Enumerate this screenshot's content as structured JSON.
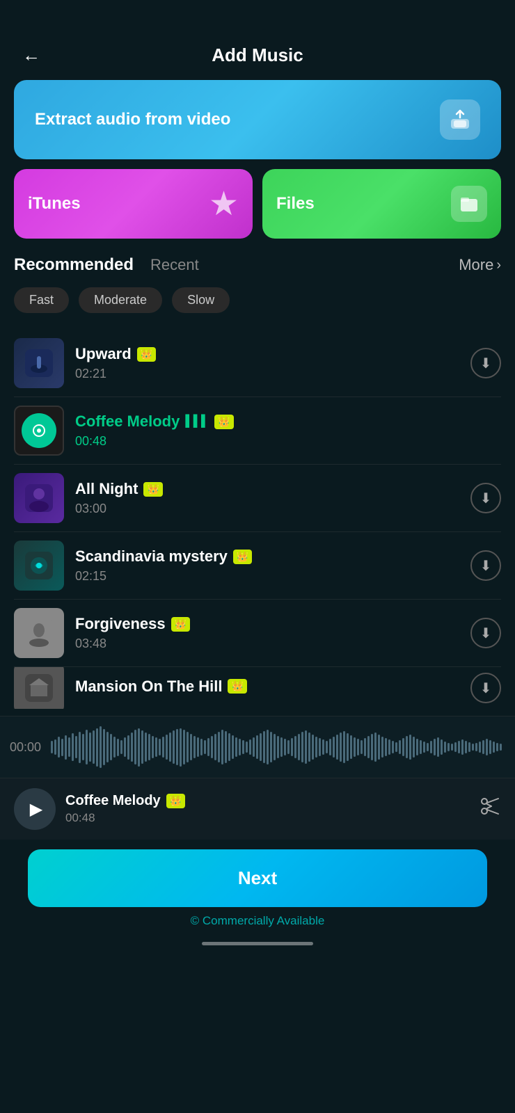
{
  "app": {
    "title": "Add Music",
    "back_label": "←"
  },
  "buttons": {
    "extract_audio": "Extract audio from video",
    "itunes": "iTunes",
    "files": "Files",
    "more": "More",
    "next": "Next",
    "commercially_available": "© Commercially Available"
  },
  "tabs": {
    "recommended": "Recommended",
    "recent": "Recent"
  },
  "filters": [
    {
      "id": "fast",
      "label": "Fast"
    },
    {
      "id": "moderate",
      "label": "Moderate"
    },
    {
      "id": "slow",
      "label": "Slow"
    }
  ],
  "tracks": [
    {
      "id": "upward",
      "name": "Upward",
      "duration": "02:21",
      "premium": true,
      "playing": false,
      "thumb_type": "upward"
    },
    {
      "id": "coffee-melody",
      "name": "Coffee Melody",
      "duration": "00:48",
      "premium": true,
      "playing": true,
      "thumb_type": "coffee"
    },
    {
      "id": "all-night",
      "name": "All Night",
      "duration": "03:00",
      "premium": true,
      "playing": false,
      "thumb_type": "allnight"
    },
    {
      "id": "scandinavia",
      "name": "Scandinavia mystery",
      "duration": "02:15",
      "premium": true,
      "playing": false,
      "thumb_type": "scandinavia"
    },
    {
      "id": "forgiveness",
      "name": "Forgiveness",
      "duration": "03:48",
      "premium": true,
      "playing": false,
      "thumb_type": "forgiveness"
    },
    {
      "id": "mansion",
      "name": "Mansion On The Hill",
      "duration": "",
      "premium": true,
      "playing": false,
      "thumb_type": "mansion"
    }
  ],
  "player": {
    "name": "Coffee Melody",
    "duration": "00:48",
    "time_label": "00:00"
  }
}
